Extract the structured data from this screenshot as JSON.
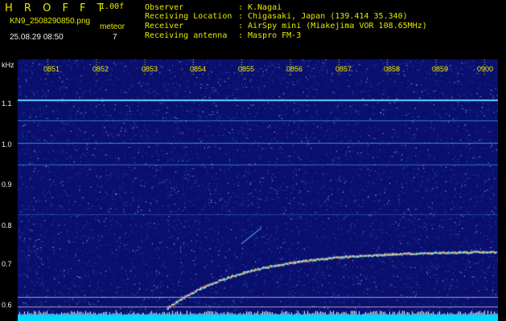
{
  "header": {
    "brand": "H R O F F T",
    "version": "1.00f",
    "filename": "KN9_2508290850.png",
    "timestamp": "25.08.29 08:50",
    "mode": "meteor",
    "channel": "7",
    "meta": [
      {
        "label": "Observer",
        "value": "K.Nagai"
      },
      {
        "label": "Receiving Location",
        "value": "Chigasaki, Japan (139.414 35.340)"
      },
      {
        "label": "Receiver",
        "value": "AirSpy mini (Miakejima VOR 108.65MHz)"
      },
      {
        "label": "Receiving antenna",
        "value": "Maspro FM-3"
      }
    ]
  },
  "spectrogram": {
    "freq_unit": "kHz",
    "y_ticks": [
      "1.1",
      "1.0",
      "0.9",
      "0.8",
      "0.7",
      "0.6"
    ],
    "time_ticks": [
      "0851",
      "0852",
      "0853",
      "0854",
      "0855",
      "0856",
      "0857",
      "0858",
      "0859",
      "0900"
    ],
    "colors": {
      "noise_bg": "#0a0f6e",
      "trace": "#66ddff",
      "meteor": "#ff4444",
      "floor": "#00d8ff"
    }
  }
}
